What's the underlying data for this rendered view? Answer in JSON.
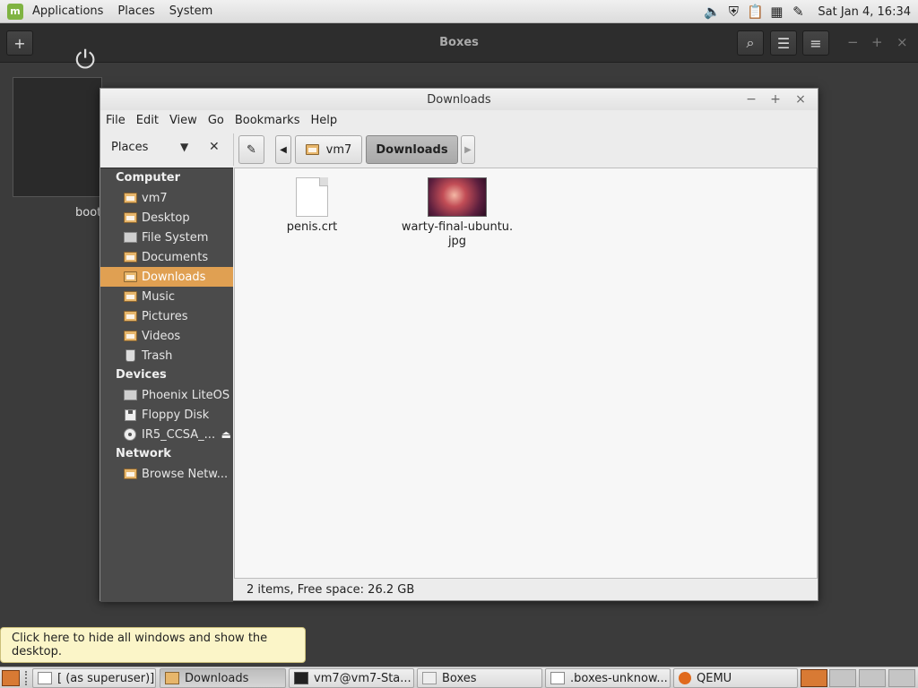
{
  "top_panel": {
    "logo": "mint-logo",
    "menus": [
      "Applications",
      "Places",
      "System"
    ],
    "tray_icons": [
      "volume-icon",
      "shield-icon",
      "clipboard-icon",
      "calendar-icon",
      "pen-icon"
    ],
    "clock": "Sat Jan  4, 16:34"
  },
  "boxes": {
    "title": "Boxes",
    "new_button_icon": "plus-icon",
    "search_icon": "search-icon",
    "view_icon": "list-view-icon",
    "menu_icon": "hamburger-icon",
    "wm": [
      "−",
      "+",
      "×"
    ],
    "vm_label": "boot"
  },
  "caja": {
    "title": "Downloads",
    "wm": [
      "−",
      "+",
      "×"
    ],
    "menus": [
      "File",
      "Edit",
      "View",
      "Go",
      "Bookmarks",
      "Help"
    ],
    "places_label": "Places",
    "path": [
      "vm7",
      "Downloads"
    ],
    "sidebar": {
      "computer_heading": "Computer",
      "computer_items": [
        {
          "label": "vm7",
          "icon": "home-folder-icon"
        },
        {
          "label": "Desktop",
          "icon": "desktop-folder-icon"
        },
        {
          "label": "File System",
          "icon": "filesystem-icon"
        },
        {
          "label": "Documents",
          "icon": "documents-folder-icon"
        },
        {
          "label": "Downloads",
          "icon": "downloads-folder-icon",
          "active": true
        },
        {
          "label": "Music",
          "icon": "music-folder-icon"
        },
        {
          "label": "Pictures",
          "icon": "pictures-folder-icon"
        },
        {
          "label": "Videos",
          "icon": "videos-folder-icon"
        },
        {
          "label": "Trash",
          "icon": "trash-icon"
        }
      ],
      "devices_heading": "Devices",
      "device_items": [
        {
          "label": "Phoenix LiteOS",
          "icon": "harddisk-icon"
        },
        {
          "label": "Floppy Disk",
          "icon": "floppy-icon"
        },
        {
          "label": "IR5_CCSA_...",
          "icon": "cdrom-icon"
        }
      ],
      "network_heading": "Network",
      "network_items": [
        {
          "label": "Browse Netw...",
          "icon": "network-icon"
        }
      ]
    },
    "files": [
      {
        "name": "penis.crt",
        "icon": "document-icon"
      },
      {
        "name_line1": "warty-final-ubuntu.",
        "name_line2": "jpg",
        "icon": "image-thumbnail-icon"
      }
    ],
    "status": "2 items, Free space: 26.2 GB"
  },
  "tooltip": "Click here to hide all windows and show the desktop.",
  "taskbar": {
    "tasks": [
      {
        "label": "[ (as superuser)]",
        "icon": "editor-icon"
      },
      {
        "label": "Downloads",
        "icon": "folder-icon",
        "active": true
      },
      {
        "label": "vm7@vm7-Sta...",
        "icon": "terminal-icon"
      },
      {
        "label": "Boxes",
        "icon": "boxes-icon"
      },
      {
        "label": ".boxes-unknow...",
        "icon": "text-editor-icon"
      },
      {
        "label": "QEMU",
        "icon": "qemu-icon"
      }
    ],
    "workspaces": 4
  },
  "colors": {
    "accent": "#e0a052",
    "sidebar_bg": "#4b4b4b",
    "boxes_bg": "#3b3b3b"
  }
}
